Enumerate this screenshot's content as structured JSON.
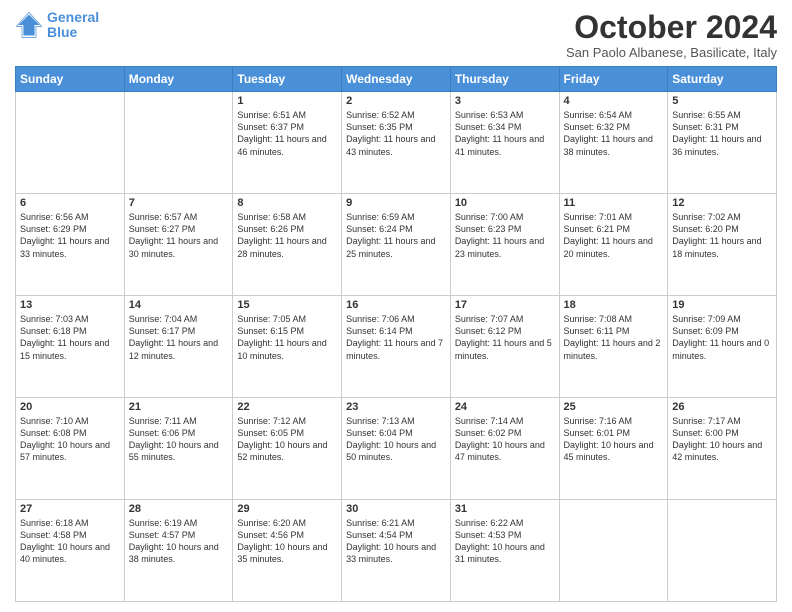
{
  "header": {
    "logo_line1": "General",
    "logo_line2": "Blue",
    "title": "October 2024",
    "subtitle": "San Paolo Albanese, Basilicate, Italy"
  },
  "columns": [
    "Sunday",
    "Monday",
    "Tuesday",
    "Wednesday",
    "Thursday",
    "Friday",
    "Saturday"
  ],
  "weeks": [
    [
      {
        "day": "",
        "info": ""
      },
      {
        "day": "",
        "info": ""
      },
      {
        "day": "1",
        "info": "Sunrise: 6:51 AM\nSunset: 6:37 PM\nDaylight: 11 hours and 46 minutes."
      },
      {
        "day": "2",
        "info": "Sunrise: 6:52 AM\nSunset: 6:35 PM\nDaylight: 11 hours and 43 minutes."
      },
      {
        "day": "3",
        "info": "Sunrise: 6:53 AM\nSunset: 6:34 PM\nDaylight: 11 hours and 41 minutes."
      },
      {
        "day": "4",
        "info": "Sunrise: 6:54 AM\nSunset: 6:32 PM\nDaylight: 11 hours and 38 minutes."
      },
      {
        "day": "5",
        "info": "Sunrise: 6:55 AM\nSunset: 6:31 PM\nDaylight: 11 hours and 36 minutes."
      }
    ],
    [
      {
        "day": "6",
        "info": "Sunrise: 6:56 AM\nSunset: 6:29 PM\nDaylight: 11 hours and 33 minutes."
      },
      {
        "day": "7",
        "info": "Sunrise: 6:57 AM\nSunset: 6:27 PM\nDaylight: 11 hours and 30 minutes."
      },
      {
        "day": "8",
        "info": "Sunrise: 6:58 AM\nSunset: 6:26 PM\nDaylight: 11 hours and 28 minutes."
      },
      {
        "day": "9",
        "info": "Sunrise: 6:59 AM\nSunset: 6:24 PM\nDaylight: 11 hours and 25 minutes."
      },
      {
        "day": "10",
        "info": "Sunrise: 7:00 AM\nSunset: 6:23 PM\nDaylight: 11 hours and 23 minutes."
      },
      {
        "day": "11",
        "info": "Sunrise: 7:01 AM\nSunset: 6:21 PM\nDaylight: 11 hours and 20 minutes."
      },
      {
        "day": "12",
        "info": "Sunrise: 7:02 AM\nSunset: 6:20 PM\nDaylight: 11 hours and 18 minutes."
      }
    ],
    [
      {
        "day": "13",
        "info": "Sunrise: 7:03 AM\nSunset: 6:18 PM\nDaylight: 11 hours and 15 minutes."
      },
      {
        "day": "14",
        "info": "Sunrise: 7:04 AM\nSunset: 6:17 PM\nDaylight: 11 hours and 12 minutes."
      },
      {
        "day": "15",
        "info": "Sunrise: 7:05 AM\nSunset: 6:15 PM\nDaylight: 11 hours and 10 minutes."
      },
      {
        "day": "16",
        "info": "Sunrise: 7:06 AM\nSunset: 6:14 PM\nDaylight: 11 hours and 7 minutes."
      },
      {
        "day": "17",
        "info": "Sunrise: 7:07 AM\nSunset: 6:12 PM\nDaylight: 11 hours and 5 minutes."
      },
      {
        "day": "18",
        "info": "Sunrise: 7:08 AM\nSunset: 6:11 PM\nDaylight: 11 hours and 2 minutes."
      },
      {
        "day": "19",
        "info": "Sunrise: 7:09 AM\nSunset: 6:09 PM\nDaylight: 11 hours and 0 minutes."
      }
    ],
    [
      {
        "day": "20",
        "info": "Sunrise: 7:10 AM\nSunset: 6:08 PM\nDaylight: 10 hours and 57 minutes."
      },
      {
        "day": "21",
        "info": "Sunrise: 7:11 AM\nSunset: 6:06 PM\nDaylight: 10 hours and 55 minutes."
      },
      {
        "day": "22",
        "info": "Sunrise: 7:12 AM\nSunset: 6:05 PM\nDaylight: 10 hours and 52 minutes."
      },
      {
        "day": "23",
        "info": "Sunrise: 7:13 AM\nSunset: 6:04 PM\nDaylight: 10 hours and 50 minutes."
      },
      {
        "day": "24",
        "info": "Sunrise: 7:14 AM\nSunset: 6:02 PM\nDaylight: 10 hours and 47 minutes."
      },
      {
        "day": "25",
        "info": "Sunrise: 7:16 AM\nSunset: 6:01 PM\nDaylight: 10 hours and 45 minutes."
      },
      {
        "day": "26",
        "info": "Sunrise: 7:17 AM\nSunset: 6:00 PM\nDaylight: 10 hours and 42 minutes."
      }
    ],
    [
      {
        "day": "27",
        "info": "Sunrise: 6:18 AM\nSunset: 4:58 PM\nDaylight: 10 hours and 40 minutes."
      },
      {
        "day": "28",
        "info": "Sunrise: 6:19 AM\nSunset: 4:57 PM\nDaylight: 10 hours and 38 minutes."
      },
      {
        "day": "29",
        "info": "Sunrise: 6:20 AM\nSunset: 4:56 PM\nDaylight: 10 hours and 35 minutes."
      },
      {
        "day": "30",
        "info": "Sunrise: 6:21 AM\nSunset: 4:54 PM\nDaylight: 10 hours and 33 minutes."
      },
      {
        "day": "31",
        "info": "Sunrise: 6:22 AM\nSunset: 4:53 PM\nDaylight: 10 hours and 31 minutes."
      },
      {
        "day": "",
        "info": ""
      },
      {
        "day": "",
        "info": ""
      }
    ]
  ]
}
